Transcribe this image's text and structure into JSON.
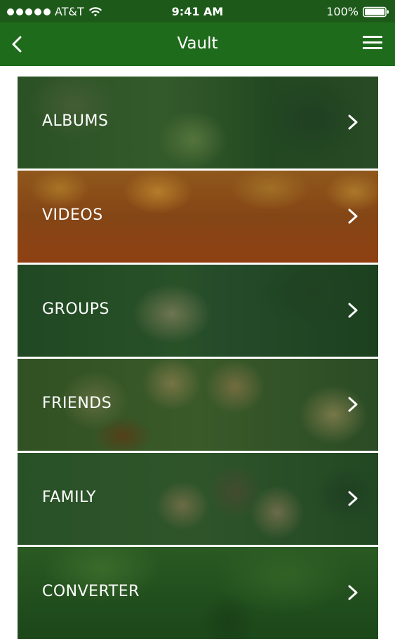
{
  "status_bar": {
    "carrier": "AT&T",
    "time": "9:41 AM",
    "battery": "100%"
  },
  "nav": {
    "title": "Vault",
    "back_icon": "chevron-left-icon",
    "menu_icon": "hamburger-menu-icon"
  },
  "colors": {
    "nav_background": "#1f6b1c",
    "status_background": "#1d5a1a",
    "tile_overlay_green": "#14461a",
    "tile_overlay_orange": "#963c0a"
  },
  "menu_items": [
    {
      "label": "ALBUMS"
    },
    {
      "label": "VIDEOS"
    },
    {
      "label": "GROUPS"
    },
    {
      "label": "FRIENDS"
    },
    {
      "label": "FAMILY"
    },
    {
      "label": "CONVERTER"
    }
  ]
}
